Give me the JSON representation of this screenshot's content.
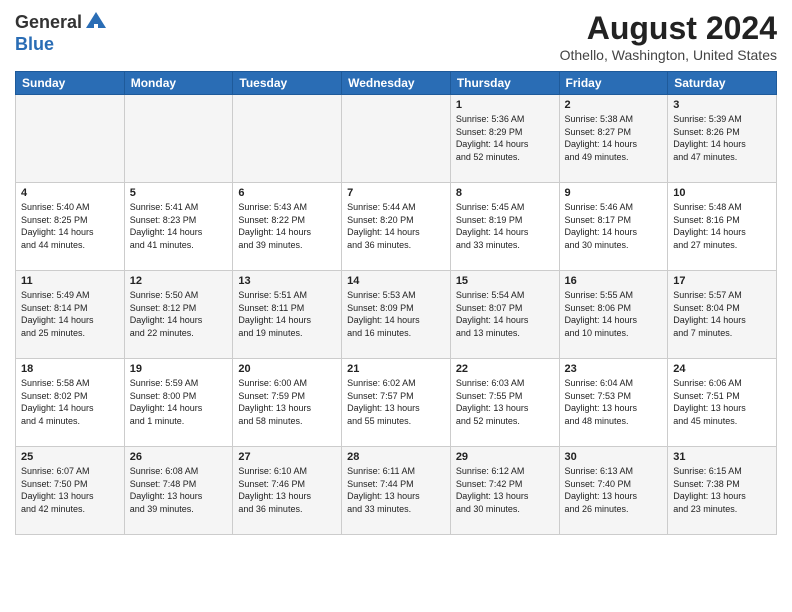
{
  "header": {
    "logo_general": "General",
    "logo_blue": "Blue",
    "title": "August 2024",
    "subtitle": "Othello, Washington, United States"
  },
  "weekdays": [
    "Sunday",
    "Monday",
    "Tuesday",
    "Wednesday",
    "Thursday",
    "Friday",
    "Saturday"
  ],
  "weeks": [
    [
      {
        "day": "",
        "info": ""
      },
      {
        "day": "",
        "info": ""
      },
      {
        "day": "",
        "info": ""
      },
      {
        "day": "",
        "info": ""
      },
      {
        "day": "1",
        "info": "Sunrise: 5:36 AM\nSunset: 8:29 PM\nDaylight: 14 hours\nand 52 minutes."
      },
      {
        "day": "2",
        "info": "Sunrise: 5:38 AM\nSunset: 8:27 PM\nDaylight: 14 hours\nand 49 minutes."
      },
      {
        "day": "3",
        "info": "Sunrise: 5:39 AM\nSunset: 8:26 PM\nDaylight: 14 hours\nand 47 minutes."
      }
    ],
    [
      {
        "day": "4",
        "info": "Sunrise: 5:40 AM\nSunset: 8:25 PM\nDaylight: 14 hours\nand 44 minutes."
      },
      {
        "day": "5",
        "info": "Sunrise: 5:41 AM\nSunset: 8:23 PM\nDaylight: 14 hours\nand 41 minutes."
      },
      {
        "day": "6",
        "info": "Sunrise: 5:43 AM\nSunset: 8:22 PM\nDaylight: 14 hours\nand 39 minutes."
      },
      {
        "day": "7",
        "info": "Sunrise: 5:44 AM\nSunset: 8:20 PM\nDaylight: 14 hours\nand 36 minutes."
      },
      {
        "day": "8",
        "info": "Sunrise: 5:45 AM\nSunset: 8:19 PM\nDaylight: 14 hours\nand 33 minutes."
      },
      {
        "day": "9",
        "info": "Sunrise: 5:46 AM\nSunset: 8:17 PM\nDaylight: 14 hours\nand 30 minutes."
      },
      {
        "day": "10",
        "info": "Sunrise: 5:48 AM\nSunset: 8:16 PM\nDaylight: 14 hours\nand 27 minutes."
      }
    ],
    [
      {
        "day": "11",
        "info": "Sunrise: 5:49 AM\nSunset: 8:14 PM\nDaylight: 14 hours\nand 25 minutes."
      },
      {
        "day": "12",
        "info": "Sunrise: 5:50 AM\nSunset: 8:12 PM\nDaylight: 14 hours\nand 22 minutes."
      },
      {
        "day": "13",
        "info": "Sunrise: 5:51 AM\nSunset: 8:11 PM\nDaylight: 14 hours\nand 19 minutes."
      },
      {
        "day": "14",
        "info": "Sunrise: 5:53 AM\nSunset: 8:09 PM\nDaylight: 14 hours\nand 16 minutes."
      },
      {
        "day": "15",
        "info": "Sunrise: 5:54 AM\nSunset: 8:07 PM\nDaylight: 14 hours\nand 13 minutes."
      },
      {
        "day": "16",
        "info": "Sunrise: 5:55 AM\nSunset: 8:06 PM\nDaylight: 14 hours\nand 10 minutes."
      },
      {
        "day": "17",
        "info": "Sunrise: 5:57 AM\nSunset: 8:04 PM\nDaylight: 14 hours\nand 7 minutes."
      }
    ],
    [
      {
        "day": "18",
        "info": "Sunrise: 5:58 AM\nSunset: 8:02 PM\nDaylight: 14 hours\nand 4 minutes."
      },
      {
        "day": "19",
        "info": "Sunrise: 5:59 AM\nSunset: 8:00 PM\nDaylight: 14 hours\nand 1 minute."
      },
      {
        "day": "20",
        "info": "Sunrise: 6:00 AM\nSunset: 7:59 PM\nDaylight: 13 hours\nand 58 minutes."
      },
      {
        "day": "21",
        "info": "Sunrise: 6:02 AM\nSunset: 7:57 PM\nDaylight: 13 hours\nand 55 minutes."
      },
      {
        "day": "22",
        "info": "Sunrise: 6:03 AM\nSunset: 7:55 PM\nDaylight: 13 hours\nand 52 minutes."
      },
      {
        "day": "23",
        "info": "Sunrise: 6:04 AM\nSunset: 7:53 PM\nDaylight: 13 hours\nand 48 minutes."
      },
      {
        "day": "24",
        "info": "Sunrise: 6:06 AM\nSunset: 7:51 PM\nDaylight: 13 hours\nand 45 minutes."
      }
    ],
    [
      {
        "day": "25",
        "info": "Sunrise: 6:07 AM\nSunset: 7:50 PM\nDaylight: 13 hours\nand 42 minutes."
      },
      {
        "day": "26",
        "info": "Sunrise: 6:08 AM\nSunset: 7:48 PM\nDaylight: 13 hours\nand 39 minutes."
      },
      {
        "day": "27",
        "info": "Sunrise: 6:10 AM\nSunset: 7:46 PM\nDaylight: 13 hours\nand 36 minutes."
      },
      {
        "day": "28",
        "info": "Sunrise: 6:11 AM\nSunset: 7:44 PM\nDaylight: 13 hours\nand 33 minutes."
      },
      {
        "day": "29",
        "info": "Sunrise: 6:12 AM\nSunset: 7:42 PM\nDaylight: 13 hours\nand 30 minutes."
      },
      {
        "day": "30",
        "info": "Sunrise: 6:13 AM\nSunset: 7:40 PM\nDaylight: 13 hours\nand 26 minutes."
      },
      {
        "day": "31",
        "info": "Sunrise: 6:15 AM\nSunset: 7:38 PM\nDaylight: 13 hours\nand 23 minutes."
      }
    ]
  ]
}
